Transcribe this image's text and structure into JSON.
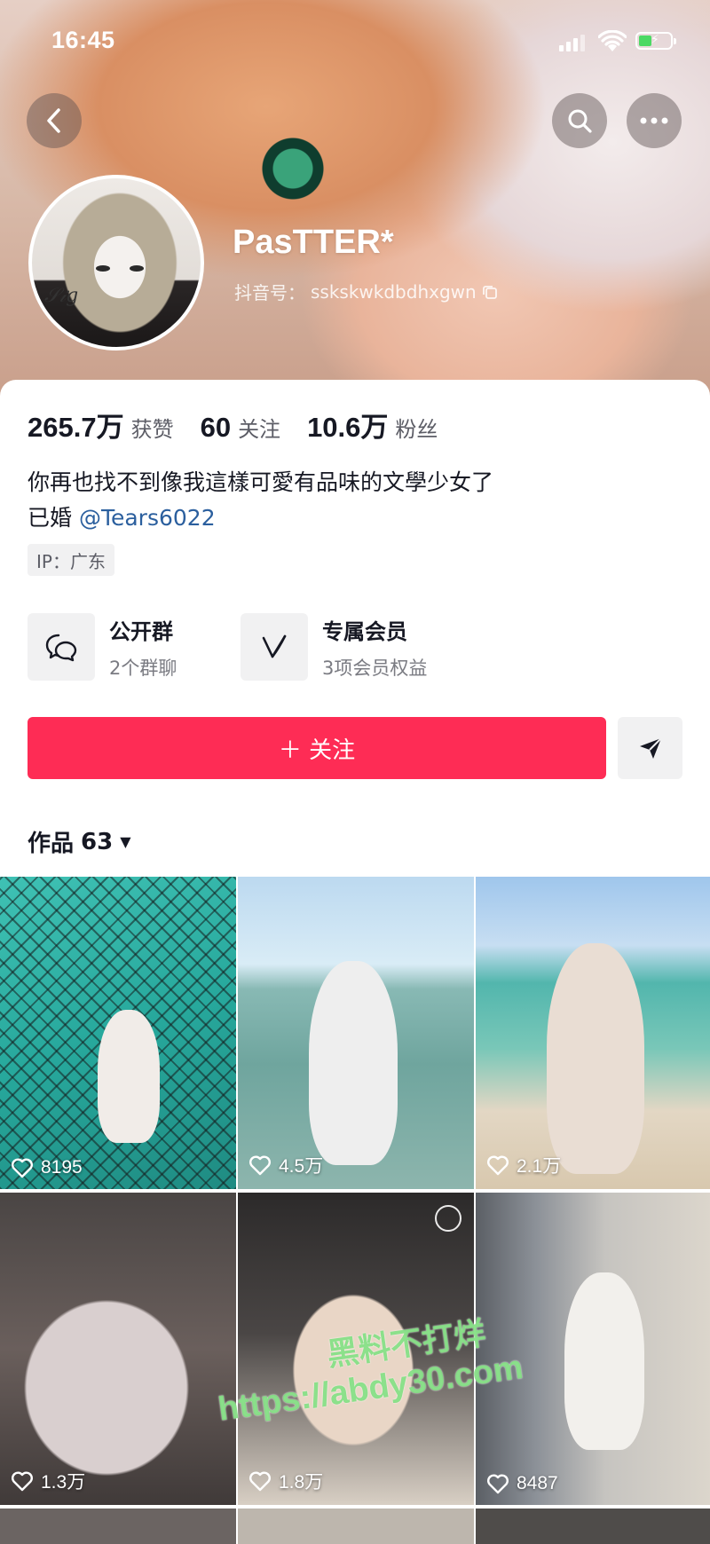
{
  "status_bar": {
    "time": "16:45"
  },
  "profile": {
    "username": "PasTTER*",
    "douyin_id_label": "抖音号：",
    "douyin_id": "sskskwkdbdhxgwn"
  },
  "stats": [
    {
      "value": "265.7万",
      "label": "获赞"
    },
    {
      "value": "60",
      "label": "关注"
    },
    {
      "value": "10.6万",
      "label": "粉丝"
    }
  ],
  "bio": {
    "line1": "你再也找不到像我這樣可愛有品味的文學少女了",
    "line2_prefix": "已婚 ",
    "mention": "@Tears6022"
  },
  "ip_location": "IP：广东",
  "features": [
    {
      "title": "公开群",
      "subtitle": "2个群聊",
      "icon": "chat-bubbles-icon"
    },
    {
      "title": "专属会员",
      "subtitle": "3项会员权益",
      "icon": "member-v-icon"
    }
  ],
  "actions": {
    "follow_label": "＋ 关注",
    "share_icon": "send-arrow-icon"
  },
  "works_tab": {
    "label": "作品",
    "count": "63"
  },
  "videos": [
    {
      "likes": "8195"
    },
    {
      "likes": "4.5万"
    },
    {
      "likes": "2.1万"
    },
    {
      "likes": "1.3万"
    },
    {
      "likes": "1.8万"
    },
    {
      "likes": "8487"
    }
  ],
  "watermark": {
    "line1": "黑料不打烊",
    "line2": "https://abdy30.com"
  },
  "colors": {
    "accent": "#fe2c55",
    "mention": "#2b5f9e",
    "text": "#161823",
    "muted": "#5c5d66"
  }
}
